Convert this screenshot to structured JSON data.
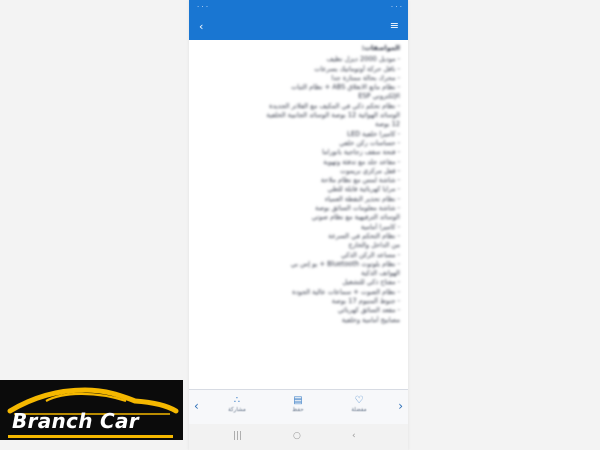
{
  "status_bar": {
    "time": "· · ·",
    "carrier": "· · ·"
  },
  "app_bar": {
    "back_glyph": "‹",
    "menu_glyph": "≡"
  },
  "content": {
    "heading": "المواصفات:",
    "lines": [
      "- موديل 2000 ديزل نظيف",
      "- ناقل حركة أوتوماتيك بسرعات",
      "- محرك بحالة ممتازة جدا",
      "- نظام مانع الانغلاق ABS + نظام الثبات",
      "الإلكتروني ESP",
      "- نظام تحكم ذكي في المكيف مع الفلاتر الجديدة",
      "الوسائد الهوائية 12 بوصة الوسائد الجانبية الخلفية",
      "12 بوصة",
      "- كاميرا خلفية LED",
      "- حساسات ركن خلفي",
      "- فتحة سقف زجاجية بانوراما",
      "- مقاعد جلد مع تدفئة وتهوية",
      "- قفل مركزي بريموت",
      "- شاشة لمس مع نظام ملاحة",
      "- مرايا كهربائية قابلة للطي",
      "- نظام تحذير النقطة العمياء",
      "- شاشة معلومات السائق بوصة",
      "الوسائد الترفيهية مع نظام صوتي",
      "- كاميرا أمامية",
      "- نظام التحكم في السرعة",
      "من الداخل والخارج",
      "- مساعد الركن الذكي",
      "- نظام بلوتوث Bluetooth + يو إس بي",
      "الهواتف الذكية",
      "- مفتاح ذكي للتشغيل",
      "- نظام الصوت + سماعات عالية الجودة",
      "- جنوط ألمنيوم 17 بوصة",
      "- مقعد السائق كهربائي",
      "مصابيح أمامية وخلفية"
    ]
  },
  "bottom_bar": {
    "prev_glyph": "‹",
    "next_glyph": "›",
    "actions": [
      {
        "icon": "share-icon",
        "glyph": "∴",
        "label": "مشاركة"
      },
      {
        "icon": "save-icon",
        "glyph": "▤",
        "label": "حفظ"
      },
      {
        "icon": "favorite-icon",
        "glyph": "♡",
        "label": "مفضلة"
      }
    ]
  },
  "system_nav": {
    "recent_glyph": "|||",
    "home_glyph": "○",
    "back_glyph": "‹"
  },
  "logo": {
    "text": "Branch Car"
  },
  "colors": {
    "app_bar": "#1976d2",
    "logo_accent": "#f5b800",
    "logo_bg": "#0b0b0b"
  }
}
